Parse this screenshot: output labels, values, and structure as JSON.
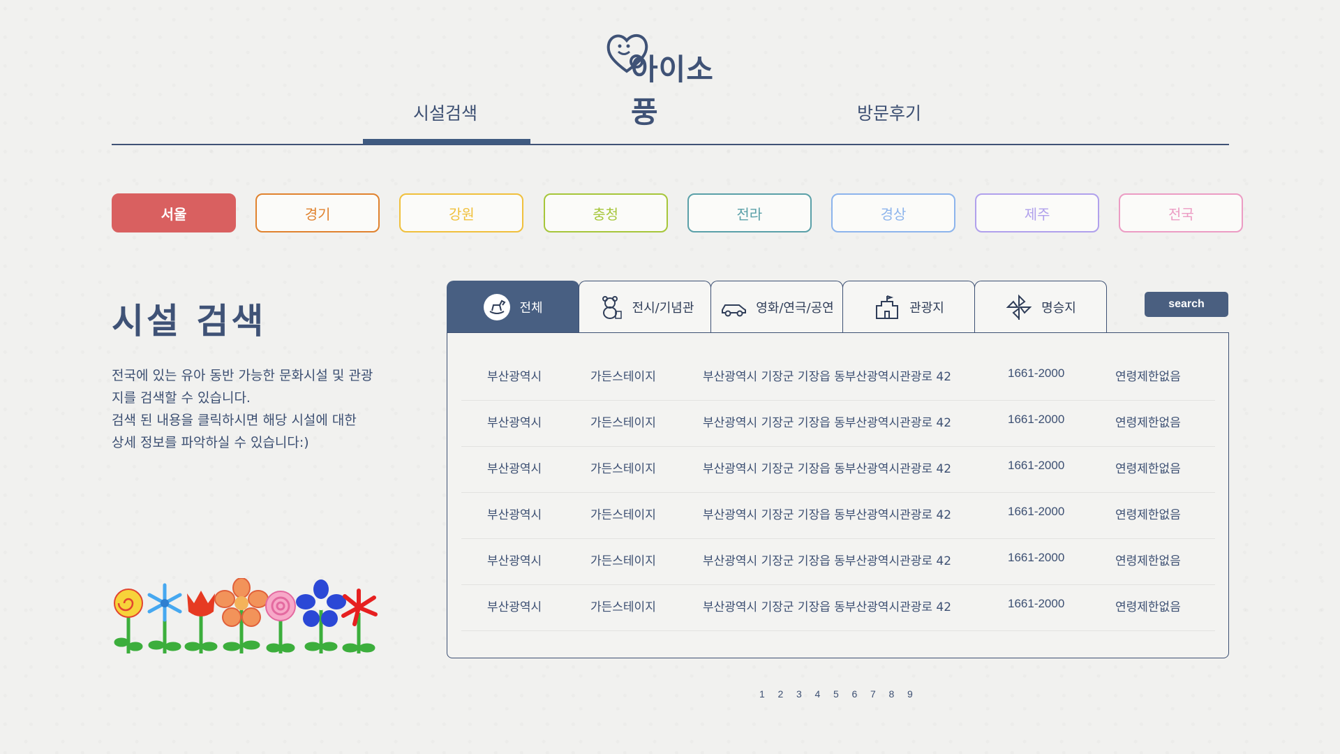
{
  "logo": {
    "text": "아이소풍"
  },
  "nav": {
    "tabs": [
      {
        "label": "시설검색"
      },
      {
        "label": "방문후기"
      }
    ]
  },
  "regions": [
    {
      "label": "서울",
      "color": "#d96060",
      "active": true
    },
    {
      "label": "경기",
      "color": "#e0822e"
    },
    {
      "label": "강원",
      "color": "#f0c03c"
    },
    {
      "label": "충청",
      "color": "#a6c63a"
    },
    {
      "label": "전라",
      "color": "#5aa0a8"
    },
    {
      "label": "경상",
      "color": "#8cb4ec"
    },
    {
      "label": "제주",
      "color": "#b0a0ec"
    },
    {
      "label": "전국",
      "color": "#ec9cc4"
    }
  ],
  "info": {
    "title": "시설 검색",
    "line1": "전국에 있는 유아 동반 가능한 문화시설 및 관광",
    "line2": "지를 검색할 수 있습니다.",
    "line3": "검색 된 내용을 클릭하시면 해당 시설에 대한",
    "line4": "상세 정보를 파악하실 수 있습니다:)"
  },
  "categories": [
    {
      "label": "전체",
      "icon": "rocking-horse-icon"
    },
    {
      "label": "전시/기념관",
      "icon": "teddy-bear-icon"
    },
    {
      "label": "영화/연극/공연",
      "icon": "toy-car-icon"
    },
    {
      "label": "관광지",
      "icon": "castle-icon"
    },
    {
      "label": "명승지",
      "icon": "pinwheel-icon"
    }
  ],
  "search": {
    "label": "search"
  },
  "results": [
    {
      "city": "부산광역시",
      "name": "가든스테이지",
      "address": "부산광역시 기장군 기장읍 동부산광역시관광로 42",
      "phone": "1661-2000",
      "age": "연령제한없음"
    },
    {
      "city": "부산광역시",
      "name": "가든스테이지",
      "address": "부산광역시 기장군 기장읍 동부산광역시관광로 42",
      "phone": "1661-2000",
      "age": "연령제한없음"
    },
    {
      "city": "부산광역시",
      "name": "가든스테이지",
      "address": "부산광역시 기장군 기장읍 동부산광역시관광로 42",
      "phone": "1661-2000",
      "age": "연령제한없음"
    },
    {
      "city": "부산광역시",
      "name": "가든스테이지",
      "address": "부산광역시 기장군 기장읍 동부산광역시관광로 42",
      "phone": "1661-2000",
      "age": "연령제한없음"
    },
    {
      "city": "부산광역시",
      "name": "가든스테이지",
      "address": "부산광역시 기장군 기장읍 동부산광역시관광로 42",
      "phone": "1661-2000",
      "age": "연령제한없음"
    },
    {
      "city": "부산광역시",
      "name": "가든스테이지",
      "address": "부산광역시 기장군 기장읍 동부산광역시관광로 42",
      "phone": "1661-2000",
      "age": "연령제한없음"
    }
  ],
  "pagination": [
    "1",
    "2",
    "3",
    "4",
    "5",
    "6",
    "7",
    "8",
    "9"
  ]
}
